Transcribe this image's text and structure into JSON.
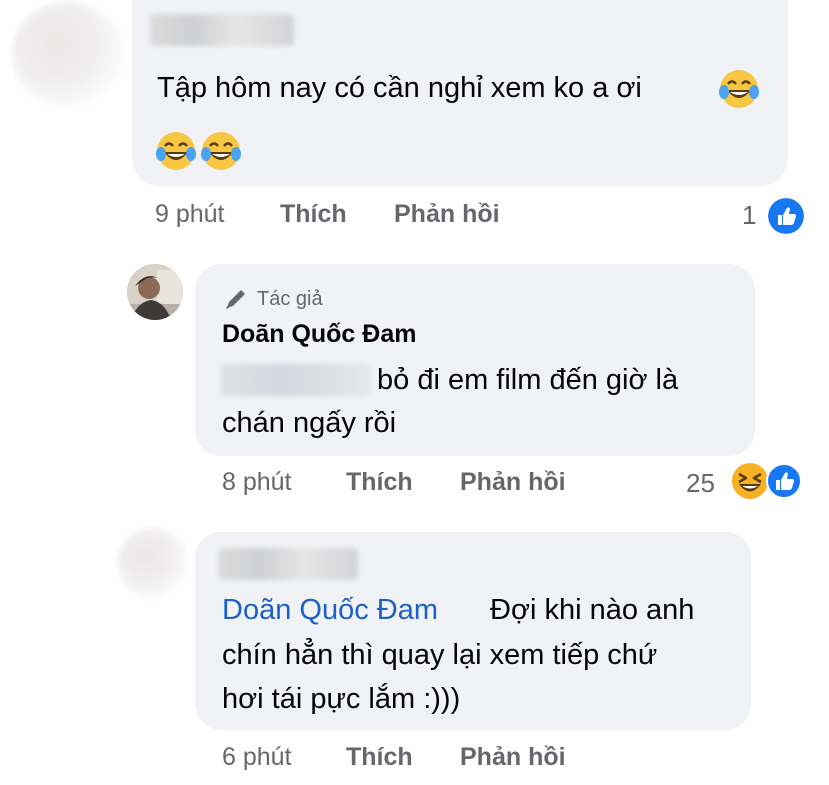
{
  "comments": [
    {
      "text": "Tập hôm nay có cần nghỉ xem ko a ơi",
      "time": "9 phút",
      "like_label": "Thích",
      "reply_label": "Phản hồi",
      "reaction_count": "1",
      "reactions": [
        "like"
      ],
      "emoji_inline": [
        "laughing-crying-emoji",
        "laughing-crying-emoji",
        "laughing-crying-emoji"
      ]
    },
    {
      "author_badge": "Tác giả",
      "author_name": "Doãn Quốc Đam",
      "text_line1": "bỏ đi em film đến giờ là",
      "text_line2": "chán ngấy rồi",
      "time": "8 phút",
      "like_label": "Thích",
      "reply_label": "Phản hồi",
      "reaction_count": "25",
      "reactions": [
        "haha",
        "like"
      ]
    },
    {
      "mention": "Doãn Quốc Đam",
      "text_line1": "Đợi khi nào anh",
      "text_line2": "chín hẳn thì quay lại xem tiếp chứ",
      "text_line3": "hơi tái pực lắm :)))",
      "time": "6 phút",
      "like_label": "Thích",
      "reply_label": "Phản hồi"
    }
  ],
  "colors": {
    "bubble": "#f0f2f5",
    "meta_text": "#65676b",
    "mention": "#1b61c9",
    "like_blue": "#1877f2",
    "haha_yellow": "#f7b125"
  }
}
